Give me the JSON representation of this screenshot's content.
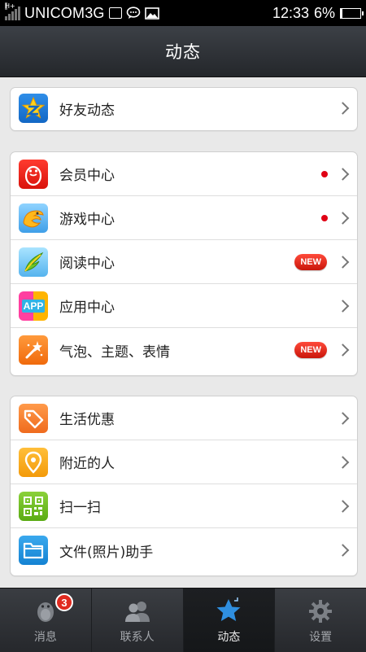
{
  "status_bar": {
    "signal_label": "H+",
    "carrier": "UNICOM3G",
    "time": "12:33",
    "battery_percent": "6%",
    "battery_level": 0.06,
    "icons": [
      "signal-icon",
      "image-icon",
      "chat-icon",
      "gallery-icon",
      "battery-icon"
    ]
  },
  "header": {
    "title": "动态"
  },
  "groups": [
    {
      "items": [
        {
          "label": "好友动态",
          "icon": "qzone-star-icon"
        }
      ]
    },
    {
      "items": [
        {
          "label": "会员中心",
          "icon": "vip-penguin-icon",
          "indicator": "dot"
        },
        {
          "label": "游戏中心",
          "icon": "game-swirl-icon",
          "indicator": "dot"
        },
        {
          "label": "阅读中心",
          "icon": "reading-feather-icon",
          "badge": "NEW"
        },
        {
          "label": "应用中心",
          "icon": "app-center-icon",
          "icon_text": "APP"
        },
        {
          "label": "气泡、主题、表情",
          "icon": "magic-wand-icon",
          "badge": "NEW"
        }
      ]
    },
    {
      "items": [
        {
          "label": "生活优惠",
          "icon": "coupon-tag-icon"
        },
        {
          "label": "附近的人",
          "icon": "location-pin-icon"
        },
        {
          "label": "扫一扫",
          "icon": "qr-scan-icon"
        },
        {
          "label": "文件(照片)助手",
          "icon": "folder-icon"
        }
      ]
    }
  ],
  "tab_bar": {
    "tabs": [
      {
        "label": "消息",
        "icon": "messages-penguin-icon",
        "badge": "3"
      },
      {
        "label": "联系人",
        "icon": "contacts-icon"
      },
      {
        "label": "动态",
        "icon": "star-icon",
        "active": true
      },
      {
        "label": "设置",
        "icon": "gear-icon"
      }
    ]
  },
  "colors": {
    "accent_red": "#e00015",
    "tab_active": "#2f8fe0",
    "header_bg": "#2e3136",
    "page_bg": "#e9e9e9"
  }
}
